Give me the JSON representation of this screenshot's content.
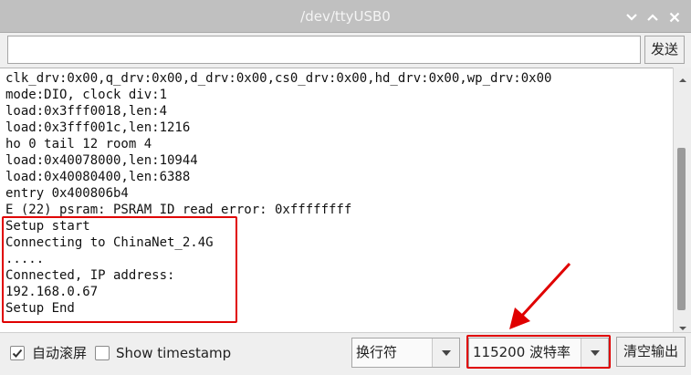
{
  "window": {
    "title": "/dev/ttyUSB0"
  },
  "send": {
    "input_value": "",
    "button_label": "发送"
  },
  "console": {
    "lines": [
      "clk_drv:0x00,q_drv:0x00,d_drv:0x00,cs0_drv:0x00,hd_drv:0x00,wp_drv:0x00",
      "mode:DIO, clock div:1",
      "load:0x3fff0018,len:4",
      "load:0x3fff001c,len:1216",
      "ho 0 tail 12 room 4",
      "load:0x40078000,len:10944",
      "load:0x40080400,len:6388",
      "entry 0x400806b4",
      "E (22) psram: PSRAM ID read error: 0xffffffff",
      "Setup start",
      "Connecting to ChinaNet_2.4G",
      ".....",
      "Connected, IP address:",
      "192.168.0.67",
      "Setup End"
    ]
  },
  "footer": {
    "autoscroll_label": "自动滚屏",
    "autoscroll_checked": true,
    "timestamp_label": "Show timestamp",
    "timestamp_checked": false,
    "line_ending_value": "换行符",
    "baud_value": "115200 波特率",
    "clear_label": "清空输出"
  },
  "colors": {
    "annotation": "#e00000",
    "titlebar": "#c0c0c0"
  },
  "icons": [
    "minimize-icon",
    "maximize-icon",
    "close-icon",
    "scroll-up-icon",
    "scroll-down-icon",
    "checkmark-icon",
    "dropdown-arrow-icon",
    "annotation-arrow"
  ]
}
